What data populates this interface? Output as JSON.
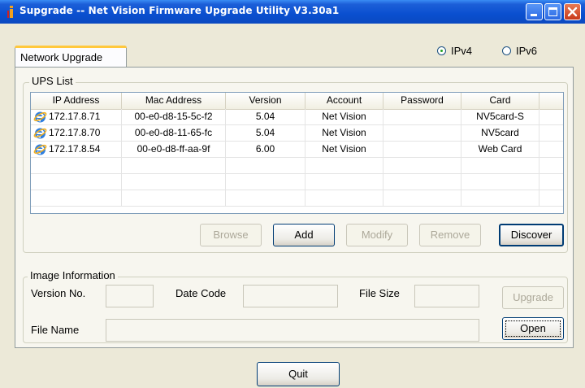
{
  "window": {
    "title": "Supgrade -- Net Vision Firmware Upgrade Utility V3.30a1"
  },
  "tabs": [
    {
      "label": "Network Upgrade",
      "selected": true
    }
  ],
  "ip_mode": {
    "options": [
      {
        "label": "IPv4",
        "checked": true
      },
      {
        "label": "IPv6",
        "checked": false
      }
    ]
  },
  "ups_list": {
    "legend": "UPS List",
    "columns": [
      "IP Address",
      "Mac Address",
      "Version",
      "Account",
      "Password",
      "Card"
    ],
    "rows": [
      {
        "ip": "172.17.8.71",
        "mac": "00-e0-d8-15-5c-f2",
        "version": "5.04",
        "account": "Net Vision",
        "password": "",
        "card": "NV5card-S",
        "icon": "ie-globe-icon"
      },
      {
        "ip": "172.17.8.70",
        "mac": "00-e0-d8-11-65-fc",
        "version": "5.04",
        "account": "Net Vision",
        "password": "",
        "card": "NV5card",
        "icon": "ie-globe-icon"
      },
      {
        "ip": "172.17.8.54",
        "mac": "00-e0-d8-ff-aa-9f",
        "version": "6.00",
        "account": "Net Vision",
        "password": "",
        "card": "Web Card",
        "icon": "ie-globe-icon"
      }
    ],
    "buttons": {
      "browse": {
        "label": "Browse",
        "enabled": false
      },
      "add": {
        "label": "Add",
        "enabled": true
      },
      "modify": {
        "label": "Modify",
        "enabled": false
      },
      "remove": {
        "label": "Remove",
        "enabled": false
      },
      "discover": {
        "label": "Discover",
        "enabled": true
      }
    }
  },
  "image_info": {
    "legend": "Image Information",
    "version_label": "Version No.",
    "version_value": "",
    "date_label": "Date Code",
    "date_value": "",
    "size_label": "File Size",
    "size_value": "",
    "filename_label": "File Name",
    "filename_value": "",
    "upgrade_label": "Upgrade",
    "open_label": "Open"
  },
  "footer": {
    "quit_label": "Quit"
  },
  "colors": {
    "titlebar": "#0a4fd0",
    "window_face": "#ece9d8",
    "tab_highlight": "#ffc83c",
    "button_border": "#003c74",
    "close_button": "#c8391a"
  }
}
